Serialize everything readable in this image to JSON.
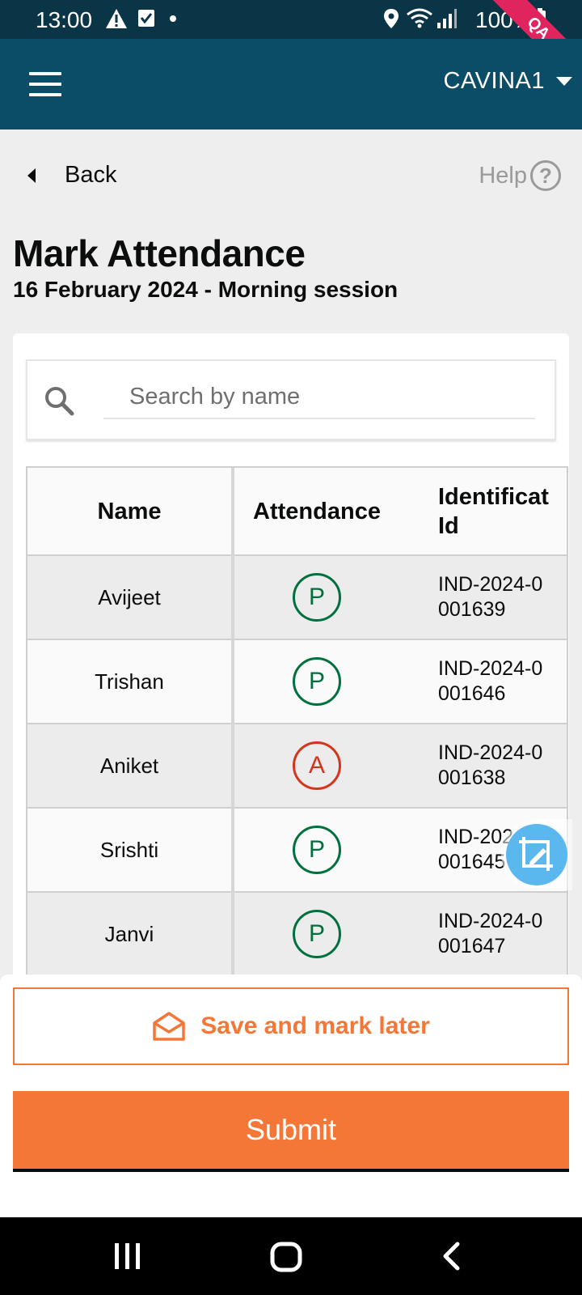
{
  "status_bar": {
    "time": "13:00",
    "battery": "100%",
    "env_badge": "QA",
    "icons": [
      "warning-icon",
      "check-box-icon",
      "dot-icon",
      "location-icon",
      "wifi-icon",
      "signal-icon",
      "battery-icon"
    ]
  },
  "header": {
    "menu_icon": "hamburger-menu-icon",
    "user": "CAVINA1"
  },
  "nav": {
    "back_label": "Back",
    "help_label": "Help"
  },
  "page": {
    "title": "Mark Attendance",
    "subtitle": "16 February 2024 - Morning session"
  },
  "search": {
    "placeholder": "Search by name",
    "value": ""
  },
  "table": {
    "headers": {
      "name": "Name",
      "attendance": "Attendance",
      "id_line1": "Identificat",
      "id_line2": "Id"
    },
    "rows": [
      {
        "name": "Avijeet",
        "attendance": "P",
        "id_line1": "IND-2024-0",
        "id_line2": "001639"
      },
      {
        "name": "Trishan",
        "attendance": "P",
        "id_line1": "IND-2024-0",
        "id_line2": "001646"
      },
      {
        "name": "Aniket",
        "attendance": "A",
        "id_line1": "IND-2024-0",
        "id_line2": "001638"
      },
      {
        "name": "Srishti",
        "attendance": "P",
        "id_line1": "IND-2024-0",
        "id_line2": "001645"
      },
      {
        "name": "Janvi",
        "attendance": "P",
        "id_line1": "IND-2024-0",
        "id_line2": "001647"
      }
    ]
  },
  "actions": {
    "save_later_label": "Save and mark later",
    "submit_label": "Submit"
  },
  "colors": {
    "header_bg": "#0b4c66",
    "status_bar_bg": "#0a3547",
    "accent_orange": "#f47738",
    "present_green": "#00703c",
    "absent_red": "#d4351c"
  }
}
